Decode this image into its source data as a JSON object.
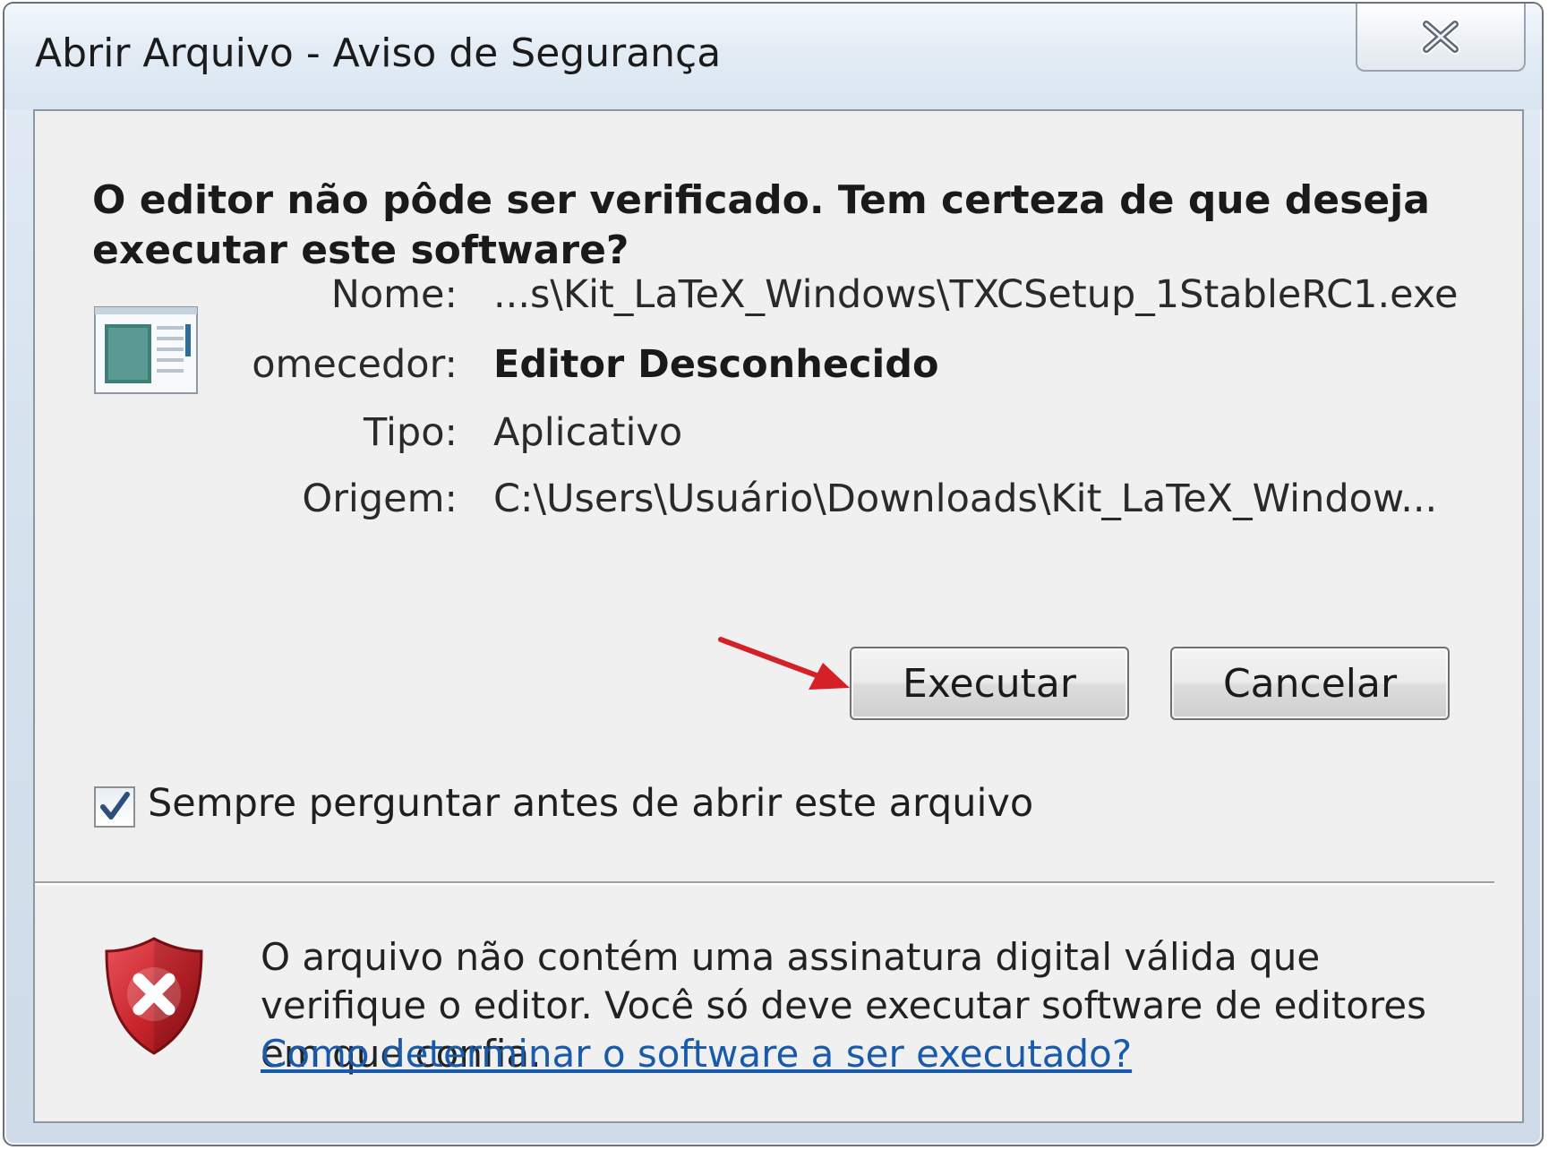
{
  "window": {
    "title": "Abrir Arquivo - Aviso de Segurança"
  },
  "dialog": {
    "headline": "O editor não pôde ser verificado. Tem certeza de que deseja executar este software?",
    "details": [
      {
        "label": "Nome:",
        "value": "...s\\Kit_LaTeX_Windows\\TXCSetup_1StableRC1.exe"
      },
      {
        "label": "omecedor:",
        "value": "Editor Desconhecido"
      },
      {
        "label": "Tipo:",
        "value": "Aplicativo"
      },
      {
        "label": "Origem:",
        "value": "C:\\Users\\Usuário\\Downloads\\Kit_LaTeX_Window..."
      }
    ],
    "buttons": {
      "execute_label": "Executar",
      "cancel_label": "Cancelar"
    },
    "checkbox": {
      "label": "Sempre perguntar antes de abrir este arquivo",
      "checked": true
    },
    "warning": {
      "text": "O arquivo não contém uma assinatura digital válida que verifique o editor. Você só deve executar software de editores em que confia.",
      "link_text": "Como determinar o software a ser executado?"
    }
  },
  "icons": {
    "close": "close-icon",
    "app": "application-icon",
    "warning": "security-shield-error-icon",
    "arrow": "red-arrow-annotation"
  },
  "colors": {
    "link": "#1a5aab",
    "shield_red": "#c8242b",
    "arrow_red": "#d42026"
  }
}
